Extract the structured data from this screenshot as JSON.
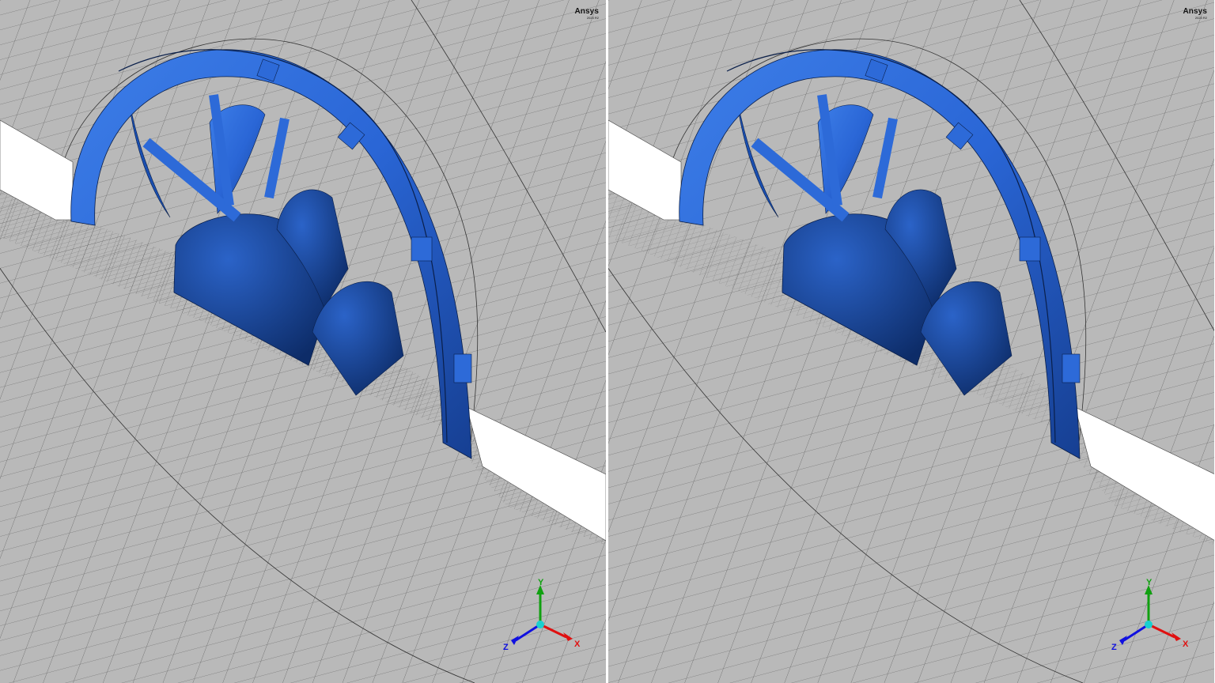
{
  "viewports": [
    {
      "id": "left",
      "logo": {
        "brand": "Ansys",
        "version": "2023 R2"
      },
      "triad": {
        "x_label": "X",
        "y_label": "Y",
        "z_label": "Z"
      }
    },
    {
      "id": "right",
      "logo": {
        "brand": "Ansys",
        "version": "2023 R2"
      },
      "triad": {
        "x_label": "X",
        "y_label": "Y",
        "z_label": "Z"
      }
    }
  ],
  "colors": {
    "background": "#b9b9b9",
    "mesh_line": "#6b6b6b",
    "geometry": "#2f6fdc",
    "geometry_dark": "#143a82",
    "slot": "#ffffff",
    "axis_x": "#e01010",
    "axis_y": "#10a010",
    "axis_z": "#1010e0",
    "axis_origin": "#19d0d0"
  }
}
